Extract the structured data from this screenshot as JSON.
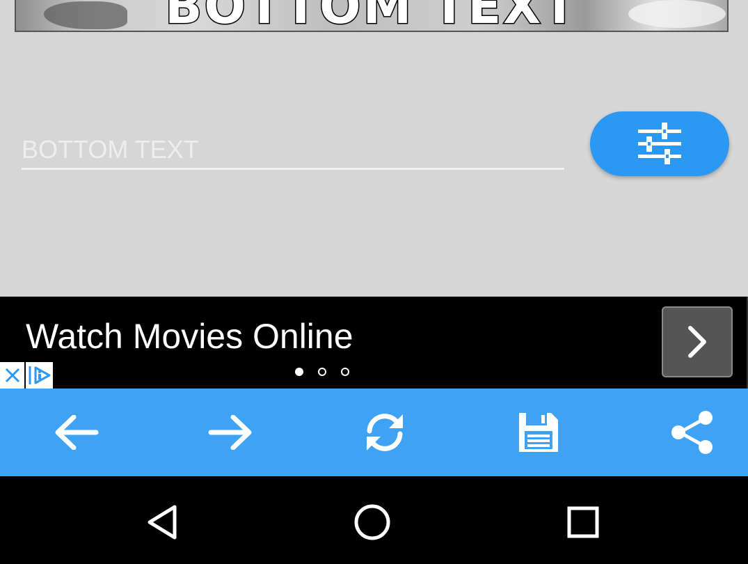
{
  "meme": {
    "caption": "BOTTOM TEXT"
  },
  "editor": {
    "input_placeholder": "BOTTOM TEXT",
    "settings_icon": "sliders-icon"
  },
  "ad": {
    "title": "Watch Movies Online",
    "slides": 3,
    "active_slide": 1,
    "icons": {
      "next": "chevron-right-icon",
      "close": "close-icon",
      "choices": "adchoices-icon"
    }
  },
  "toolbar": {
    "items": [
      {
        "name": "back",
        "icon": "arrow-left-icon"
      },
      {
        "name": "forward",
        "icon": "arrow-right-icon"
      },
      {
        "name": "refresh",
        "icon": "refresh-icon"
      },
      {
        "name": "save",
        "icon": "floppy-disk-icon"
      },
      {
        "name": "share",
        "icon": "share-icon"
      }
    ],
    "color": "#3ea2f5"
  },
  "navigation": {
    "items": [
      {
        "name": "back",
        "icon": "triangle-back-icon"
      },
      {
        "name": "home",
        "icon": "circle-home-icon"
      },
      {
        "name": "recents",
        "icon": "square-recents-icon"
      }
    ]
  },
  "colors": {
    "accent": "#2b99f3",
    "background": "#d6d6d6"
  }
}
